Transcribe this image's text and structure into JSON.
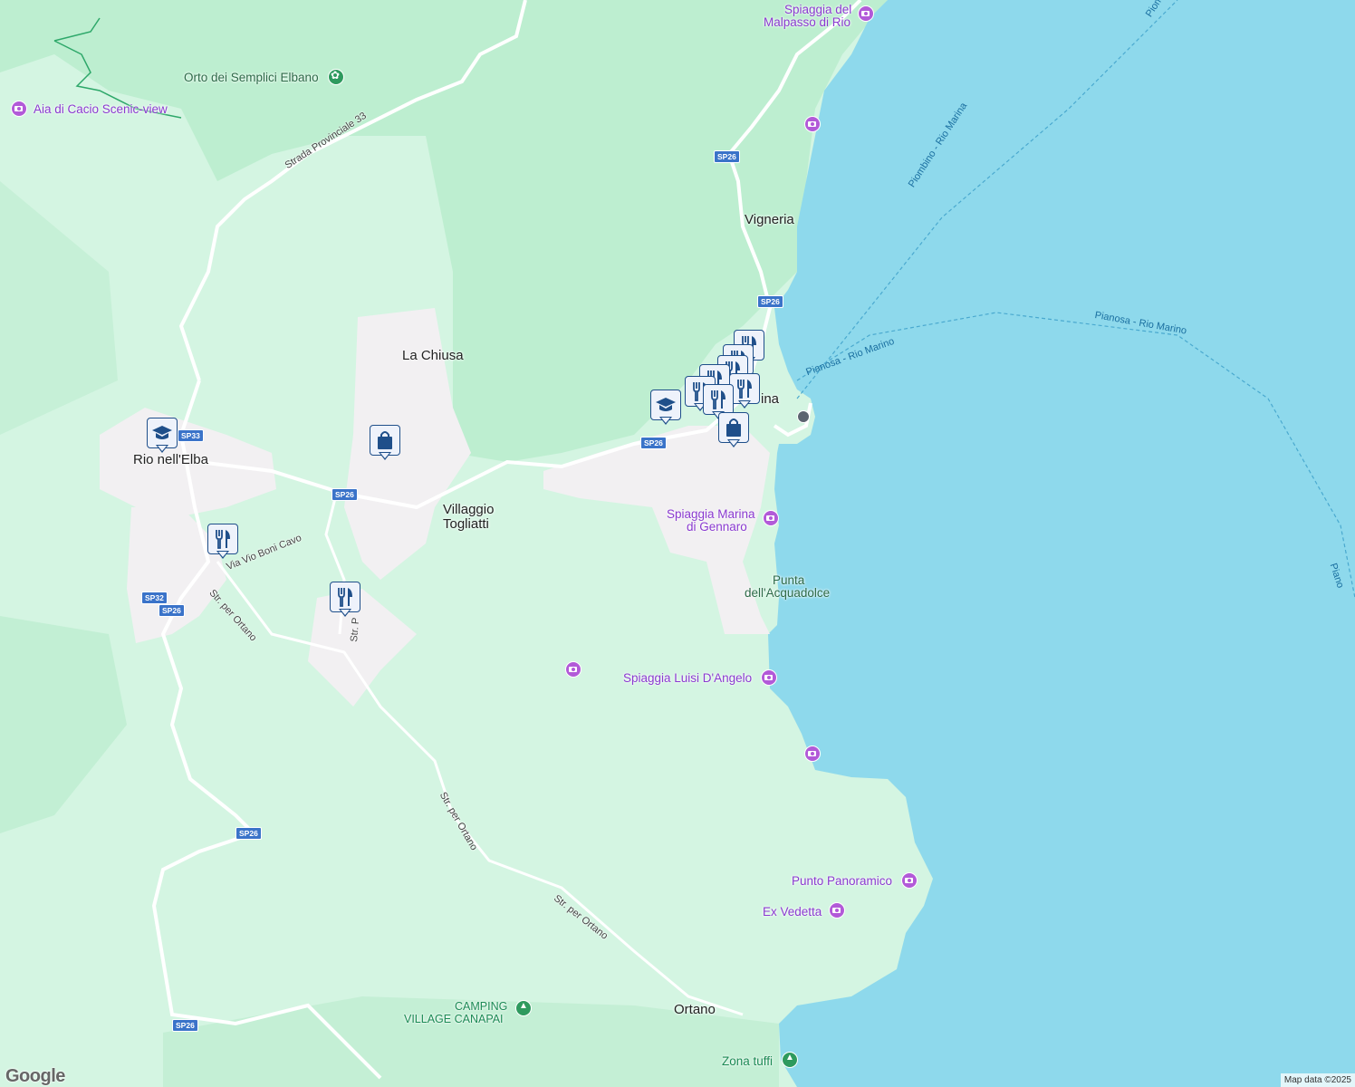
{
  "map": {
    "attribution": "Map data ©2025",
    "logo": "Google",
    "colors": {
      "land": "#d4f5e2",
      "forest": "#bdeed0",
      "sea": "#8ed9ec",
      "town": "#f2f0f2",
      "road": "#ffffff"
    }
  },
  "labels": {
    "rio_nell_elba": "Rio nell'Elba",
    "la_chiusa": "La Chiusa",
    "villaggio_togliatti_1": "Villaggio",
    "villaggio_togliatti_2": "Togliatti",
    "vigneria": "Vigneria",
    "rio_marina_partial": "ina",
    "ortano": "Ortano",
    "spiaggia_malpasso_1": "Spiaggia del",
    "spiaggia_malpasso_2": "Malpasso di Rio",
    "orto_semplici": "Orto dei Semplici Elbano",
    "aia_di_cacio": "Aia di Cacio Scenic-view",
    "spiaggia_gennaro_1": "Spiaggia Marina",
    "spiaggia_gennaro_2": "di Gennaro",
    "punta_acquadolce_1": "Punta",
    "punta_acquadolce_2": "dell'Acquadolce",
    "spiaggia_luisi": "Spiaggia Luisi D'Angelo",
    "punto_panoramico": "Punto Panoramico",
    "ex_vedetta": "Ex Vedetta",
    "camping_1": "CAMPING",
    "camping_2": "VILLAGE CANAPAI",
    "zona_tuffi": "Zona tuffi",
    "ferry_piombino_1": "Piombino - Rio Marina",
    "ferry_piombino_2": "Piomb",
    "ferry_pianosa_1": "Pianosa - Rio Marino",
    "ferry_pianosa_2": "Pianosa - Rio Marino",
    "ferry_pianosa_3": "Piano"
  },
  "roads": {
    "sp26": "SP26",
    "sp33": "SP33",
    "sp32": "SP32",
    "strada_provinciale_33": "Strada Provinciale 33",
    "str_per_ortano": "Str. per Ortano",
    "via_boni_cavo": "Via Vio Boni Cavo",
    "str_partial": "Str. P"
  },
  "markers": [
    {
      "type": "school",
      "icon": "graduation-cap-icon"
    },
    {
      "type": "shopping",
      "icon": "shopping-bag-icon"
    },
    {
      "type": "restaurant",
      "icon": "fork-knife-icon"
    },
    {
      "type": "restaurant",
      "icon": "fork-knife-icon"
    },
    {
      "type": "school",
      "icon": "graduation-cap-icon"
    },
    {
      "type": "restaurant",
      "icon": "fork-knife-icon"
    },
    {
      "type": "restaurant",
      "icon": "fork-knife-icon"
    },
    {
      "type": "shopping",
      "icon": "shopping-bag-icon"
    }
  ]
}
